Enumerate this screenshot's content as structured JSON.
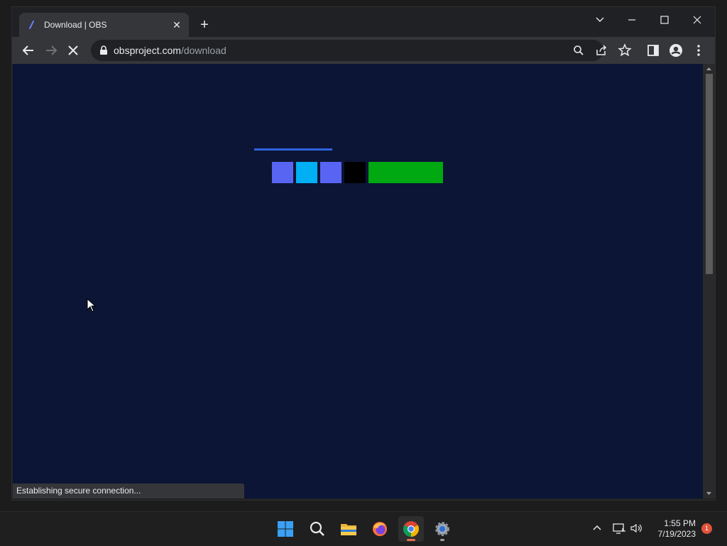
{
  "tab": {
    "title": "Download | OBS",
    "close_label": "✕",
    "new_tab_label": "+"
  },
  "window_controls": {
    "dropdown": "⌄",
    "minimize": "—",
    "maximize": "☐",
    "close": "✕"
  },
  "address_bar": {
    "domain": "obsproject.com",
    "path": "/download"
  },
  "page": {
    "blocks": [
      {
        "color": "#5865f2"
      },
      {
        "color": "#00aff4"
      },
      {
        "color": "#5865f2"
      },
      {
        "color": "#000000"
      },
      {
        "color": "#00a811"
      }
    ],
    "loading_bar_color": "#2f63e0",
    "background_color": "#0c1535"
  },
  "status_bar": {
    "text": "Establishing secure connection..."
  },
  "taskbar": {
    "apps": [
      "start-icon",
      "search-icon",
      "file-explorer-icon",
      "firefox-icon",
      "chrome-icon",
      "settings-icon"
    ],
    "clock_time": "1:55 PM",
    "clock_date": "7/19/2023",
    "notification_count": "1"
  }
}
